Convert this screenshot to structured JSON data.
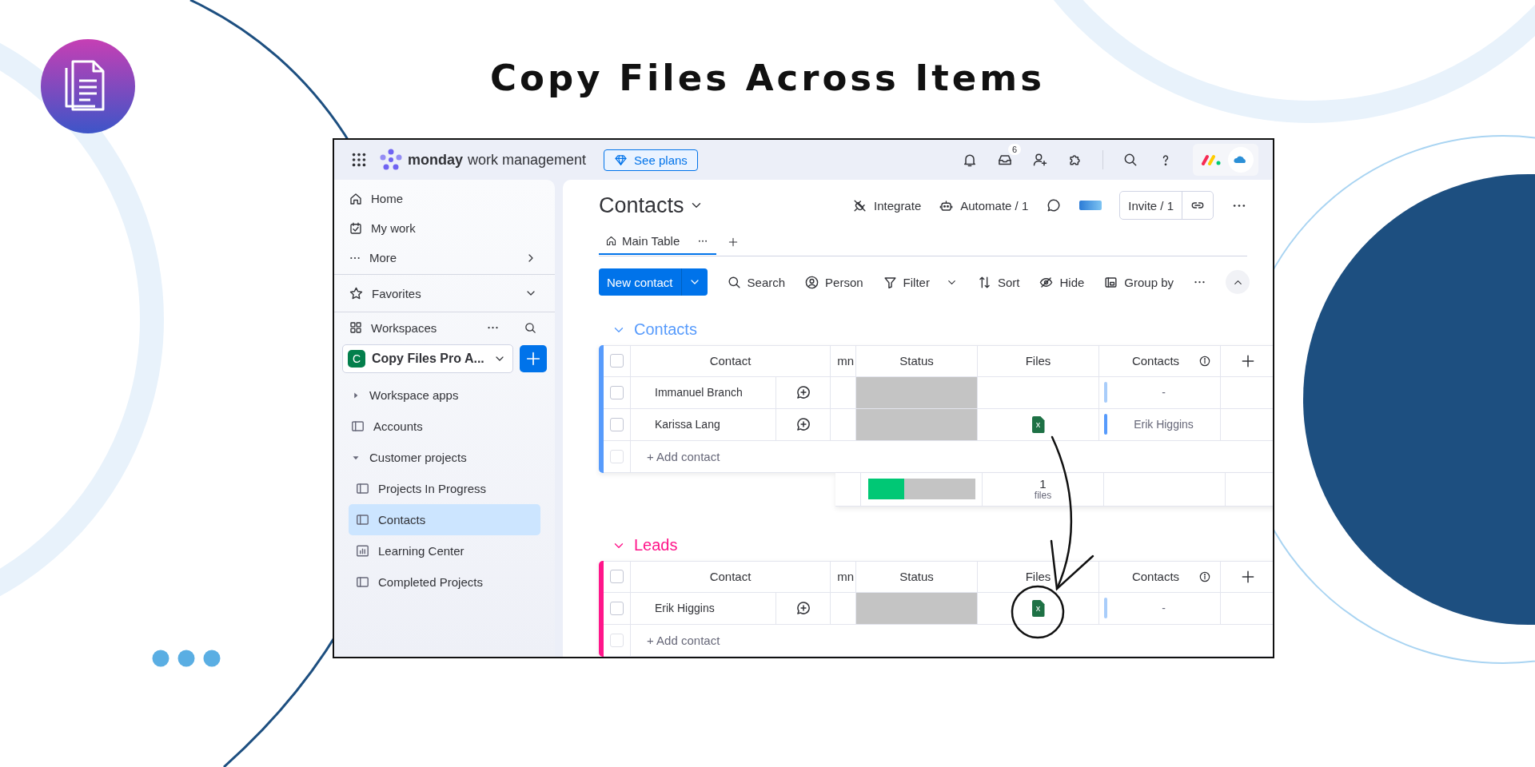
{
  "page_title": "Copy Files Across Items",
  "topbar": {
    "brand": "monday",
    "product": "work management",
    "plans_button": "See plans",
    "inbox_badge": "6"
  },
  "sidebar": {
    "nav": [
      {
        "label": "Home",
        "kind": "home"
      },
      {
        "label": "My work",
        "kind": "calendar"
      },
      {
        "label": "More",
        "kind": "more"
      }
    ],
    "favorites": "Favorites",
    "workspaces": "Workspaces",
    "workspace": {
      "initial": "C",
      "name": "Copy Files Pro A..."
    },
    "tree": [
      {
        "label": "Workspace apps",
        "kind": "folder",
        "expanded": false,
        "selected": false
      },
      {
        "label": "Accounts",
        "kind": "board",
        "selected": false
      },
      {
        "label": "Customer projects",
        "kind": "folder",
        "expanded": true,
        "selected": false,
        "children": [
          {
            "label": "Projects In Progress",
            "kind": "board",
            "selected": false
          },
          {
            "label": "Contacts",
            "kind": "board",
            "selected": true
          },
          {
            "label": "Learning Center",
            "kind": "dashboard",
            "selected": false
          },
          {
            "label": "Completed Projects",
            "kind": "board",
            "selected": false
          }
        ]
      }
    ]
  },
  "board": {
    "title": "Contacts",
    "actions": [
      {
        "label": "Integrate",
        "kind": "integrate"
      },
      {
        "label": "Automate / 1",
        "kind": "automate"
      }
    ],
    "invite": "Invite / 1",
    "views": [
      {
        "label": "Main Table",
        "selected": true
      }
    ],
    "new_button": "New contact",
    "tools": [
      {
        "label": "Search",
        "kind": "search"
      },
      {
        "label": "Person",
        "kind": "person"
      },
      {
        "label": "Filter",
        "kind": "filter"
      },
      {
        "label": "Sort",
        "kind": "sort"
      },
      {
        "label": "Hide",
        "kind": "hide"
      },
      {
        "label": "Group by",
        "kind": "group"
      }
    ]
  },
  "groups": [
    {
      "title": "Contacts",
      "color": "#579bfc",
      "columns": [
        "Contact",
        "mn",
        "Status",
        "Files",
        "Contacts"
      ],
      "all_checked": false,
      "rows": [
        {
          "name": "Immanuel Branch",
          "contact": "-",
          "linked": false,
          "checked": false
        },
        {
          "name": "Karissa Lang",
          "file": "x",
          "contact": "Erik Higgins",
          "linked": true,
          "checked": false
        }
      ],
      "add_row": "+ Add contact",
      "add_checked": false,
      "summary": {
        "level": 0.34,
        "count": "1",
        "unit": "files"
      }
    },
    {
      "title": "Leads",
      "color": "#ff158a",
      "columns": [
        "Contact",
        "mn",
        "Status",
        "Files",
        "Contacts"
      ],
      "all_checked": false,
      "rows": [
        {
          "name": "Erik Higgins",
          "file": "x",
          "contact": "-",
          "linked": false,
          "checked": false
        }
      ],
      "add_row": "+ Add contact",
      "add_checked": false
    }
  ]
}
